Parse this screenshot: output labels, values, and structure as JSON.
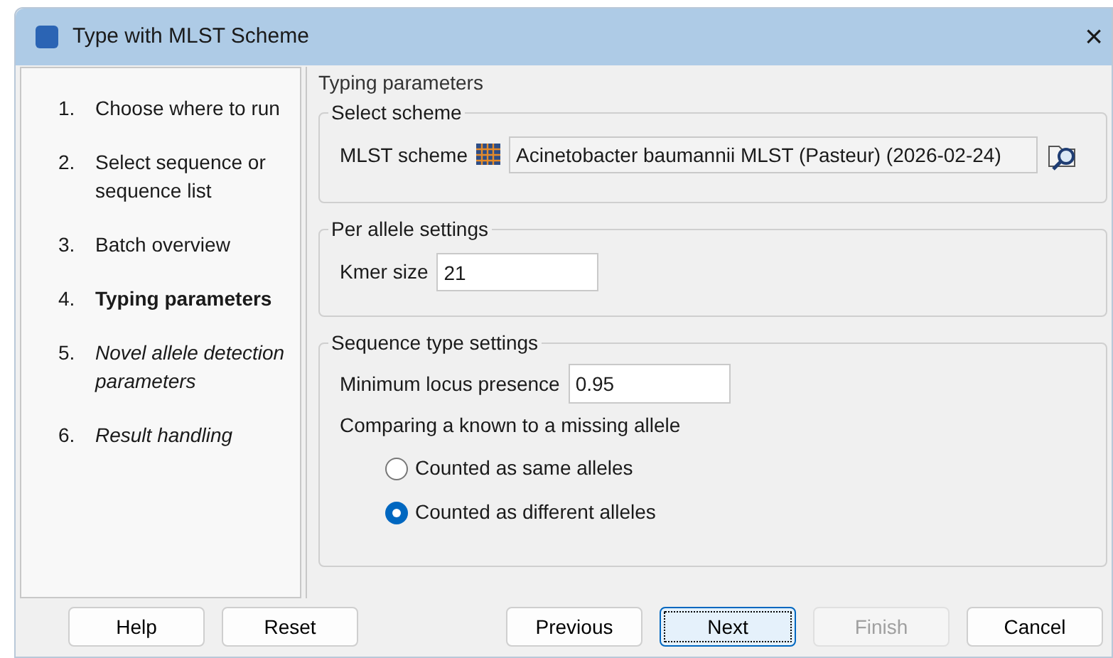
{
  "window": {
    "title": "Type with MLST Scheme",
    "close": "×"
  },
  "steps": [
    {
      "number": "1.",
      "label": "Choose where to run",
      "kind": "done"
    },
    {
      "number": "2.",
      "label": "Select sequence or sequence list",
      "kind": "done"
    },
    {
      "number": "3.",
      "label": "Batch overview",
      "kind": "done"
    },
    {
      "number": "4.",
      "label": "Typing parameters",
      "kind": "current"
    },
    {
      "number": "5.",
      "label": "Novel allele detection parameters",
      "kind": "pending"
    },
    {
      "number": "6.",
      "label": "Result handling",
      "kind": "pending"
    }
  ],
  "panel": {
    "title": "Typing parameters",
    "select_scheme": {
      "title": "Select scheme",
      "label": "MLST scheme",
      "value": "Acinetobacter baumannii MLST (Pasteur) (2026-02-24)"
    },
    "per_allele": {
      "title": "Per allele settings",
      "label": "Kmer size",
      "value": "21"
    },
    "sequence_type": {
      "title": "Sequence type settings",
      "label": "Minimum locus presence",
      "value": "0.95",
      "question": "Comparing a known to a missing allele",
      "options": [
        {
          "label": "Counted as same alleles",
          "selected": false
        },
        {
          "label": "Counted as different alleles",
          "selected": true
        }
      ]
    }
  },
  "buttons_left": [
    {
      "label": "Help",
      "disabled": false,
      "focused": false
    },
    {
      "label": "Reset",
      "disabled": false,
      "focused": false
    }
  ],
  "buttons_right": [
    {
      "label": "Previous",
      "disabled": false,
      "focused": false
    },
    {
      "label": "Next",
      "disabled": false,
      "focused": true
    },
    {
      "label": "Finish",
      "disabled": true,
      "focused": false
    },
    {
      "label": "Cancel",
      "disabled": false,
      "focused": false
    }
  ]
}
